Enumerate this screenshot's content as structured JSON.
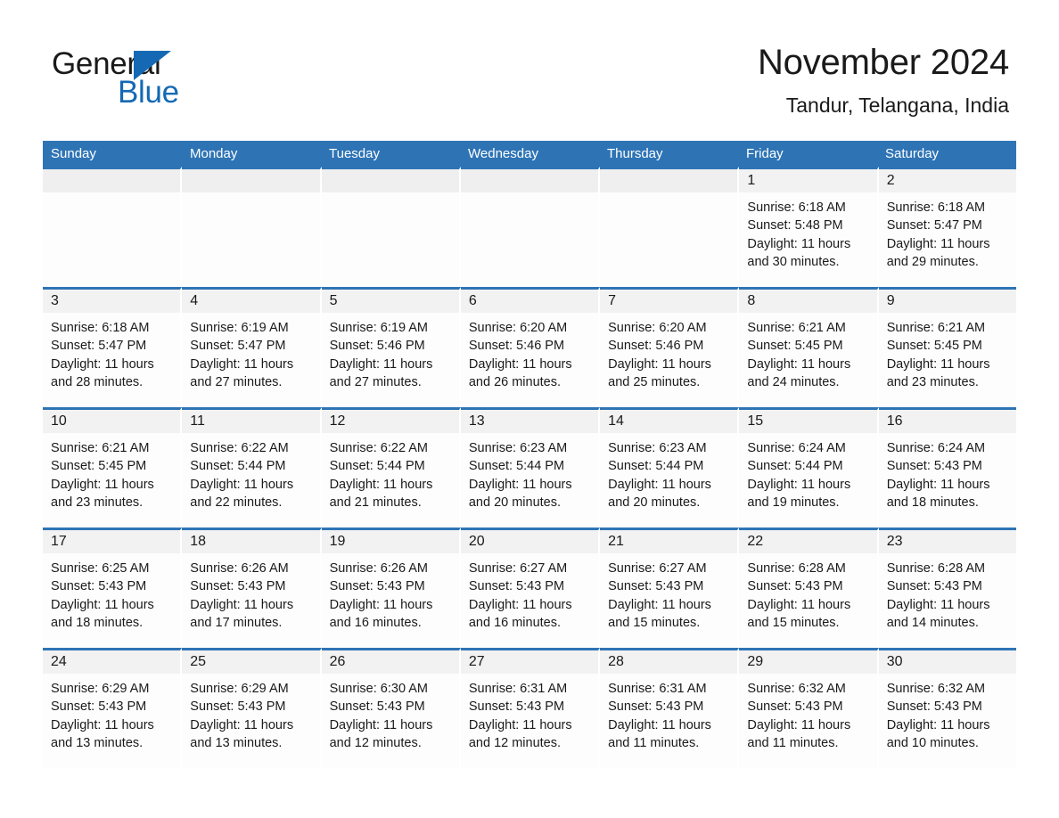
{
  "brand": {
    "name_part1": "General",
    "name_part2": "Blue",
    "accent_color": "#1569b4",
    "triangle_icon": "brand-triangle-icon"
  },
  "header": {
    "month_title": "November 2024",
    "location": "Tandur, Telangana, India"
  },
  "calendar": {
    "header_bg": "#2e74b5",
    "weekdays": [
      "Sunday",
      "Monday",
      "Tuesday",
      "Wednesday",
      "Thursday",
      "Friday",
      "Saturday"
    ],
    "weeks": [
      [
        {
          "day": "",
          "lines": []
        },
        {
          "day": "",
          "lines": []
        },
        {
          "day": "",
          "lines": []
        },
        {
          "day": "",
          "lines": []
        },
        {
          "day": "",
          "lines": []
        },
        {
          "day": "1",
          "lines": [
            "Sunrise: 6:18 AM",
            "Sunset: 5:48 PM",
            "Daylight: 11 hours",
            "and 30 minutes."
          ]
        },
        {
          "day": "2",
          "lines": [
            "Sunrise: 6:18 AM",
            "Sunset: 5:47 PM",
            "Daylight: 11 hours",
            "and 29 minutes."
          ]
        }
      ],
      [
        {
          "day": "3",
          "lines": [
            "Sunrise: 6:18 AM",
            "Sunset: 5:47 PM",
            "Daylight: 11 hours",
            "and 28 minutes."
          ]
        },
        {
          "day": "4",
          "lines": [
            "Sunrise: 6:19 AM",
            "Sunset: 5:47 PM",
            "Daylight: 11 hours",
            "and 27 minutes."
          ]
        },
        {
          "day": "5",
          "lines": [
            "Sunrise: 6:19 AM",
            "Sunset: 5:46 PM",
            "Daylight: 11 hours",
            "and 27 minutes."
          ]
        },
        {
          "day": "6",
          "lines": [
            "Sunrise: 6:20 AM",
            "Sunset: 5:46 PM",
            "Daylight: 11 hours",
            "and 26 minutes."
          ]
        },
        {
          "day": "7",
          "lines": [
            "Sunrise: 6:20 AM",
            "Sunset: 5:46 PM",
            "Daylight: 11 hours",
            "and 25 minutes."
          ]
        },
        {
          "day": "8",
          "lines": [
            "Sunrise: 6:21 AM",
            "Sunset: 5:45 PM",
            "Daylight: 11 hours",
            "and 24 minutes."
          ]
        },
        {
          "day": "9",
          "lines": [
            "Sunrise: 6:21 AM",
            "Sunset: 5:45 PM",
            "Daylight: 11 hours",
            "and 23 minutes."
          ]
        }
      ],
      [
        {
          "day": "10",
          "lines": [
            "Sunrise: 6:21 AM",
            "Sunset: 5:45 PM",
            "Daylight: 11 hours",
            "and 23 minutes."
          ]
        },
        {
          "day": "11",
          "lines": [
            "Sunrise: 6:22 AM",
            "Sunset: 5:44 PM",
            "Daylight: 11 hours",
            "and 22 minutes."
          ]
        },
        {
          "day": "12",
          "lines": [
            "Sunrise: 6:22 AM",
            "Sunset: 5:44 PM",
            "Daylight: 11 hours",
            "and 21 minutes."
          ]
        },
        {
          "day": "13",
          "lines": [
            "Sunrise: 6:23 AM",
            "Sunset: 5:44 PM",
            "Daylight: 11 hours",
            "and 20 minutes."
          ]
        },
        {
          "day": "14",
          "lines": [
            "Sunrise: 6:23 AM",
            "Sunset: 5:44 PM",
            "Daylight: 11 hours",
            "and 20 minutes."
          ]
        },
        {
          "day": "15",
          "lines": [
            "Sunrise: 6:24 AM",
            "Sunset: 5:44 PM",
            "Daylight: 11 hours",
            "and 19 minutes."
          ]
        },
        {
          "day": "16",
          "lines": [
            "Sunrise: 6:24 AM",
            "Sunset: 5:43 PM",
            "Daylight: 11 hours",
            "and 18 minutes."
          ]
        }
      ],
      [
        {
          "day": "17",
          "lines": [
            "Sunrise: 6:25 AM",
            "Sunset: 5:43 PM",
            "Daylight: 11 hours",
            "and 18 minutes."
          ]
        },
        {
          "day": "18",
          "lines": [
            "Sunrise: 6:26 AM",
            "Sunset: 5:43 PM",
            "Daylight: 11 hours",
            "and 17 minutes."
          ]
        },
        {
          "day": "19",
          "lines": [
            "Sunrise: 6:26 AM",
            "Sunset: 5:43 PM",
            "Daylight: 11 hours",
            "and 16 minutes."
          ]
        },
        {
          "day": "20",
          "lines": [
            "Sunrise: 6:27 AM",
            "Sunset: 5:43 PM",
            "Daylight: 11 hours",
            "and 16 minutes."
          ]
        },
        {
          "day": "21",
          "lines": [
            "Sunrise: 6:27 AM",
            "Sunset: 5:43 PM",
            "Daylight: 11 hours",
            "and 15 minutes."
          ]
        },
        {
          "day": "22",
          "lines": [
            "Sunrise: 6:28 AM",
            "Sunset: 5:43 PM",
            "Daylight: 11 hours",
            "and 15 minutes."
          ]
        },
        {
          "day": "23",
          "lines": [
            "Sunrise: 6:28 AM",
            "Sunset: 5:43 PM",
            "Daylight: 11 hours",
            "and 14 minutes."
          ]
        }
      ],
      [
        {
          "day": "24",
          "lines": [
            "Sunrise: 6:29 AM",
            "Sunset: 5:43 PM",
            "Daylight: 11 hours",
            "and 13 minutes."
          ]
        },
        {
          "day": "25",
          "lines": [
            "Sunrise: 6:29 AM",
            "Sunset: 5:43 PM",
            "Daylight: 11 hours",
            "and 13 minutes."
          ]
        },
        {
          "day": "26",
          "lines": [
            "Sunrise: 6:30 AM",
            "Sunset: 5:43 PM",
            "Daylight: 11 hours",
            "and 12 minutes."
          ]
        },
        {
          "day": "27",
          "lines": [
            "Sunrise: 6:31 AM",
            "Sunset: 5:43 PM",
            "Daylight: 11 hours",
            "and 12 minutes."
          ]
        },
        {
          "day": "28",
          "lines": [
            "Sunrise: 6:31 AM",
            "Sunset: 5:43 PM",
            "Daylight: 11 hours",
            "and 11 minutes."
          ]
        },
        {
          "day": "29",
          "lines": [
            "Sunrise: 6:32 AM",
            "Sunset: 5:43 PM",
            "Daylight: 11 hours",
            "and 11 minutes."
          ]
        },
        {
          "day": "30",
          "lines": [
            "Sunrise: 6:32 AM",
            "Sunset: 5:43 PM",
            "Daylight: 11 hours",
            "and 10 minutes."
          ]
        }
      ]
    ]
  }
}
